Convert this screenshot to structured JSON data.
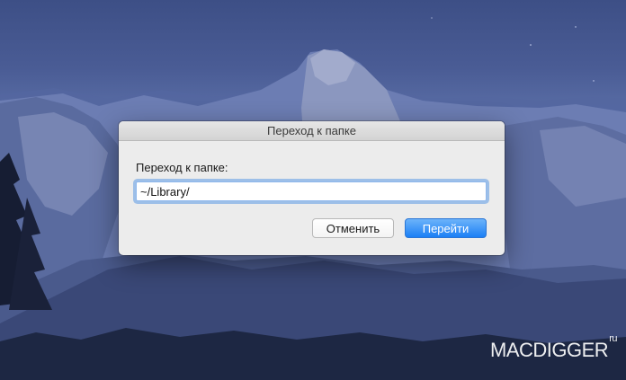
{
  "dialog": {
    "title": "Переход к папке",
    "prompt": "Переход к папке:",
    "path_value": "~/Library/",
    "cancel_label": "Отменить",
    "go_label": "Перейти"
  },
  "watermark": {
    "brand": "MACDIGGER",
    "suffix": "ru"
  },
  "colors": {
    "accent": "#1b7ff5",
    "dialog_bg": "#ececec"
  }
}
